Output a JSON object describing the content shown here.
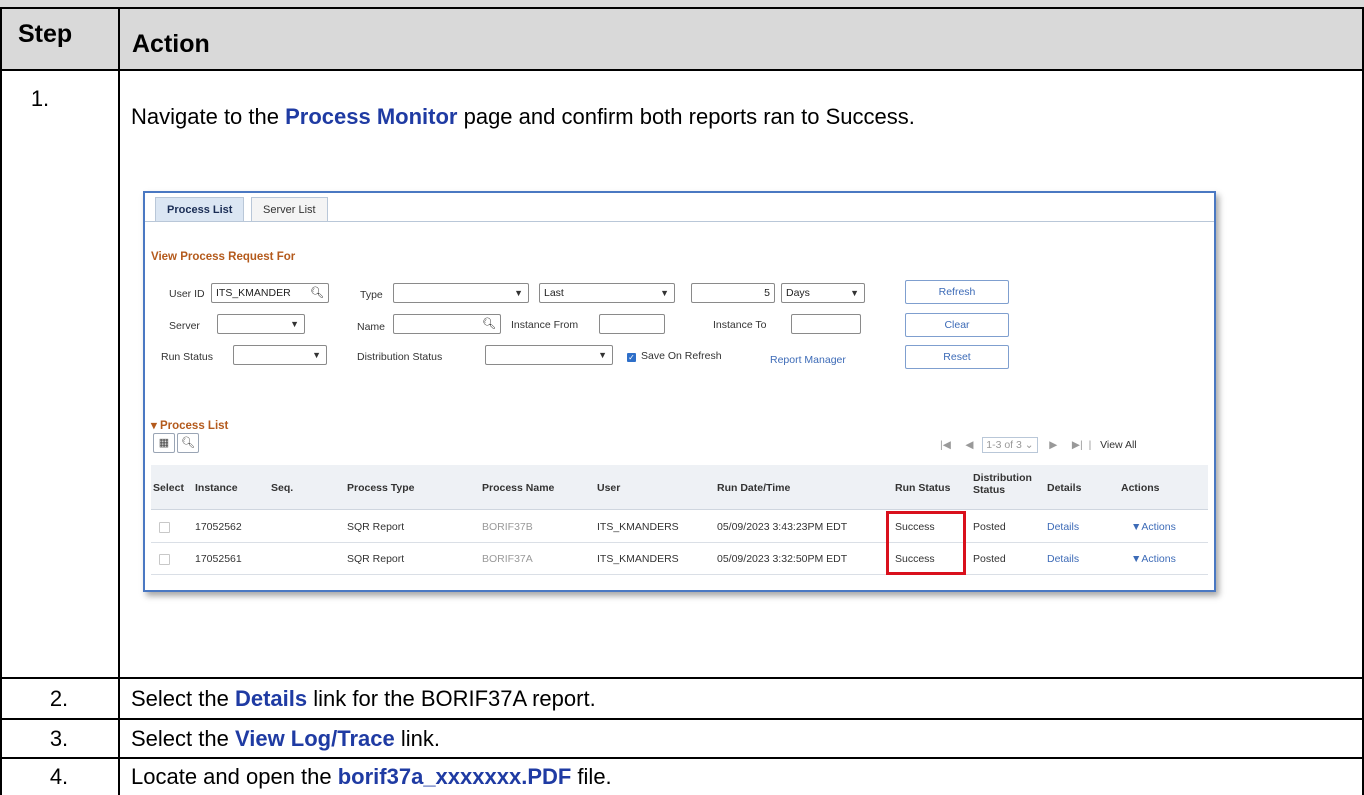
{
  "table": {
    "header": {
      "step": "Step",
      "action": "Action"
    },
    "rows": [
      {
        "step": "1.",
        "pre": "Navigate to the ",
        "kw": "Process Monitor",
        "post": " page and confirm both reports ran to Success."
      },
      {
        "step": "2.",
        "pre": "Select the ",
        "kw": "Details",
        "post": " link for the BORIF37A report."
      },
      {
        "step": "3.",
        "pre": "Select the ",
        "kw": "View Log/Trace",
        "post": " link."
      },
      {
        "step": "4.",
        "pre": "Locate and open the ",
        "kw": "borif37a_xxxxxxx.PDF",
        "post": " file."
      }
    ]
  },
  "screenshot": {
    "tabs": [
      {
        "label": "Process List"
      },
      {
        "label": "Server List"
      }
    ],
    "section_title": "View Process Request For",
    "filters": {
      "user_id_label": "User ID",
      "user_id_value": "ITS_KMANDER",
      "type_label": "Type",
      "type_value": "",
      "last_value": "Last",
      "days_number": "5",
      "days_unit": "Days",
      "server_label": "Server",
      "server_value": "",
      "name_label": "Name",
      "name_value": "",
      "instance_from_label": "Instance From",
      "instance_from_value": "",
      "instance_to_label": "Instance To",
      "instance_to_value": "",
      "run_status_label": "Run Status",
      "run_status_value": "",
      "dist_status_label": "Distribution Status",
      "dist_status_value": "",
      "save_on_refresh": "Save On Refresh",
      "report_manager": "Report Manager"
    },
    "buttons": {
      "refresh": "Refresh",
      "clear": "Clear",
      "reset": "Reset"
    },
    "process_list_title": "Process List",
    "pager": {
      "range": "1-3 of 3",
      "view_all": "View All"
    },
    "columns": {
      "select": "Select",
      "instance": "Instance",
      "seq": "Seq.",
      "process_type": "Process Type",
      "process_name": "Process Name",
      "user": "User",
      "run_datetime": "Run Date/Time",
      "run_status": "Run Status",
      "dist_status_1": "Distribution",
      "dist_status_2": "Status",
      "details": "Details",
      "actions": "Actions"
    },
    "rows": [
      {
        "instance": "17052562",
        "seq": "",
        "process_type": "SQR Report",
        "process_name": "BORIF37B",
        "user": "ITS_KMANDERS",
        "run_datetime": "05/09/2023  3:43:23PM EDT",
        "run_status": "Success",
        "dist_status": "Posted",
        "details": "Details",
        "actions": "Actions"
      },
      {
        "instance": "17052561",
        "seq": "",
        "process_type": "SQR Report",
        "process_name": "BORIF37A",
        "user": "ITS_KMANDERS",
        "run_datetime": "05/09/2023  3:32:50PM EDT",
        "run_status": "Success",
        "dist_status": "Posted",
        "details": "Details",
        "actions": "Actions"
      }
    ]
  }
}
